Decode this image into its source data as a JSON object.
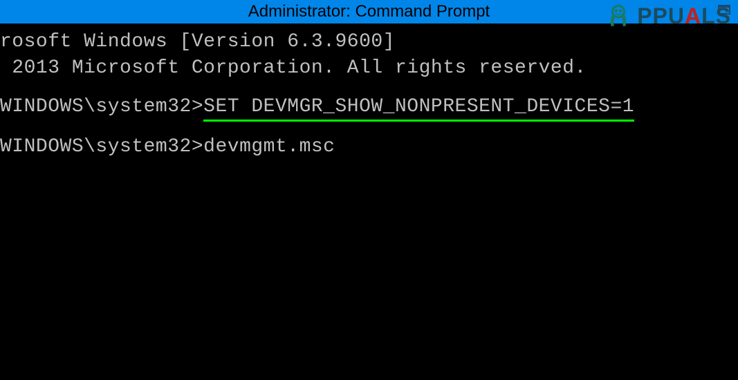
{
  "titlebar": {
    "title": "Administrator: Command Prompt"
  },
  "terminal": {
    "line1": "rosoft Windows [Version 6.3.9600]",
    "line2": " 2013 Microsoft Corporation. All rights reserved.",
    "prompt1_path": "WINDOWS\\system32>",
    "prompt1_command": "SET DEVMGR_SHOW_NONPRESENT_DEVICES=1",
    "prompt2_path": "WINDOWS\\system32>",
    "prompt2_command": "devmgmt.msc"
  },
  "watermark": {
    "text_part1": "PPU",
    "text_part2": "A",
    "text_part3": "LS"
  }
}
